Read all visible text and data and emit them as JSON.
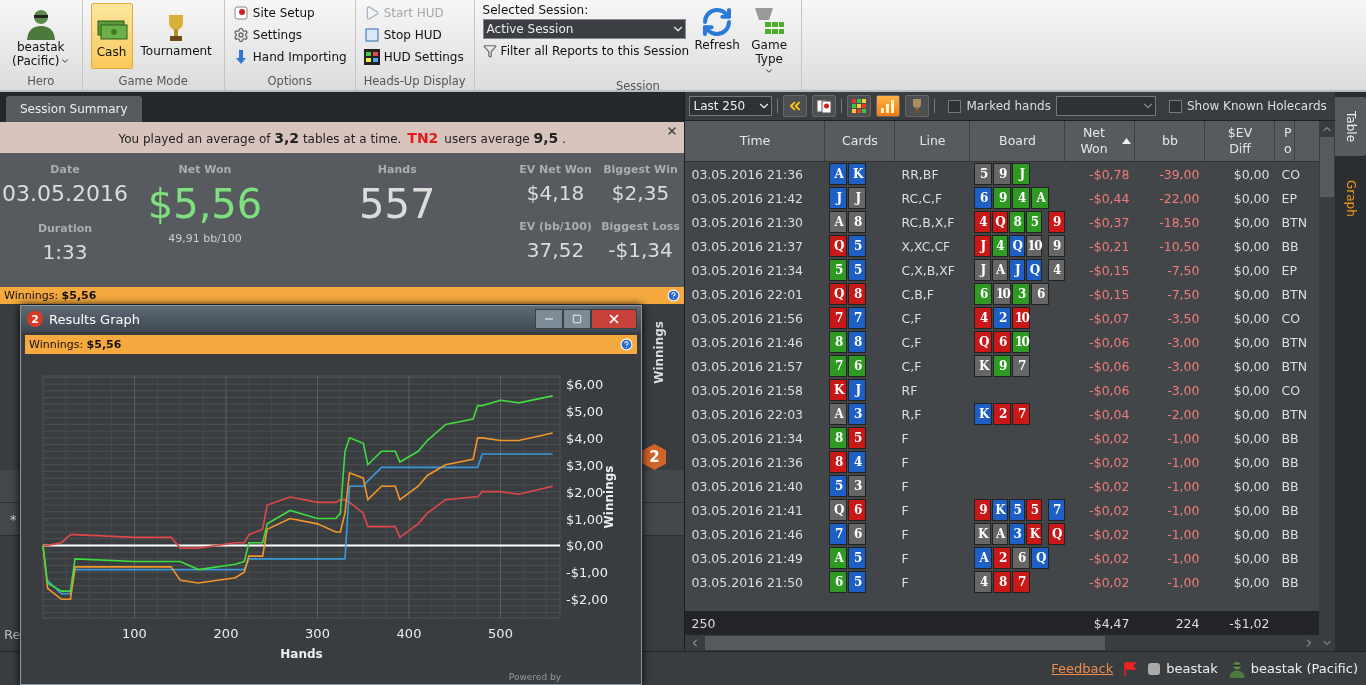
{
  "ribbon": {
    "groups": [
      {
        "kind": "hero",
        "title": "Hero",
        "user_line1": "beastak",
        "user_line2": "(Pacific)"
      },
      {
        "kind": "big",
        "title": "Game Mode",
        "buttons": [
          {
            "label": "Cash",
            "kind": "cash",
            "selected": true
          },
          {
            "label": "Tournament",
            "kind": "trophy",
            "selected": false
          }
        ]
      },
      {
        "kind": "list",
        "title": "Options",
        "items": [
          {
            "label": "Site Setup",
            "kind": "site",
            "disabled": false
          },
          {
            "label": "Settings",
            "kind": "gear",
            "disabled": false
          },
          {
            "label": "Hand Importing",
            "kind": "import",
            "disabled": false
          }
        ]
      },
      {
        "kind": "list",
        "title": "Heads-Up Display",
        "items": [
          {
            "label": "Start HUD",
            "kind": "play",
            "disabled": true
          },
          {
            "label": "Stop HUD",
            "kind": "stop",
            "disabled": false
          },
          {
            "label": "HUD Settings",
            "kind": "hud",
            "disabled": false
          }
        ]
      },
      {
        "kind": "session",
        "title": "Session",
        "label": "Selected Session:",
        "value": "Active Session",
        "filter": "Filter all Reports to this Session",
        "buttons": [
          {
            "label": "Refresh",
            "kind": "refresh"
          },
          {
            "label": "Game Type",
            "kind": "gametype"
          }
        ]
      }
    ]
  },
  "summary": {
    "tab": "Session Summary",
    "banner": {
      "text": "You played an average of **3,2** tables at a time.",
      "brand": "TN2",
      "text2": "users average **9,5** ."
    },
    "date": {
      "label": "Date",
      "value": "03.05.2016"
    },
    "duration": {
      "label": "Duration",
      "value": "1:33"
    },
    "net_won": {
      "label": "Net Won",
      "value": "$5,56",
      "sub": "49,91 bb/100"
    },
    "hands": {
      "label": "Hands",
      "value": "557"
    },
    "ev_net_won": {
      "label": "EV Net Won",
      "value": "$4,18"
    },
    "biggest_win": {
      "label": "Biggest Win",
      "value": "$2,35"
    },
    "ev_bb": {
      "label": "EV (bb/100)",
      "value": "37,52"
    },
    "biggest_loss": {
      "label": "Biggest Loss",
      "value": "-$1,34"
    },
    "winnings_bar": "Winnings: **$5,56**"
  },
  "back_panel": {
    "axis_label": "Winnings",
    "badge": "2",
    "marker": "*",
    "tab_stub": "Re"
  },
  "graph_window": {
    "badge": "2",
    "title": "Results Graph",
    "header": "Winnings: **$5,56**",
    "powered_by": "Powered by",
    "chart_data": {
      "type": "line",
      "grid": true,
      "xlabel": "Hands",
      "ylabel": "Winnings",
      "xlim": [
        0,
        565
      ],
      "ylim": [
        -2.7,
        6.3
      ],
      "x": [
        0,
        5,
        20,
        30,
        35,
        100,
        140,
        150,
        170,
        210,
        220,
        225,
        240,
        245,
        270,
        300,
        320,
        325,
        330,
        335,
        350,
        355,
        370,
        385,
        390,
        410,
        420,
        440,
        470,
        475,
        480,
        500,
        520,
        557
      ],
      "xticks": [
        100,
        200,
        300,
        400,
        500
      ],
      "yticks": [
        {
          "value": 6,
          "label": "$6,00"
        },
        {
          "value": 5,
          "label": "$5,00"
        },
        {
          "value": 4,
          "label": "$4,00"
        },
        {
          "value": 3,
          "label": "$3,00"
        },
        {
          "value": 2,
          "label": "$2,00"
        },
        {
          "value": 1,
          "label": "$1,00"
        },
        {
          "value": 0,
          "label": "$0,00"
        },
        {
          "value": -1,
          "label": "-$1,00"
        },
        {
          "value": -2,
          "label": "-$2,00"
        }
      ],
      "series": [
        {
          "color": "#e04848",
          "values": [
            0,
            0,
            0.1,
            0.4,
            0.4,
            0.3,
            0.3,
            -0.1,
            -0.1,
            0.1,
            0.1,
            0.4,
            0.6,
            1.5,
            1.8,
            1.6,
            1.6,
            1.7,
            1.7,
            1.6,
            1.2,
            0.7,
            0.7,
            0.7,
            0.3,
            0.8,
            1.2,
            1.7,
            1.8,
            1.8,
            2.0,
            2.0,
            1.9,
            2.2
          ]
        },
        {
          "color": "#3a9ad9",
          "values": [
            null,
            -1.3,
            -1.8,
            -1.8,
            -0.9,
            -0.9,
            -0.9,
            -0.9,
            -0.9,
            -0.9,
            -0.9,
            -0.5,
            -0.5,
            -0.5,
            -0.5,
            -0.5,
            -0.5,
            -0.5,
            -0.5,
            2.2,
            2.2,
            2.4,
            2.9,
            2.9,
            2.9,
            2.9,
            2.9,
            2.9,
            2.9,
            2.9,
            3.4,
            3.4,
            3.4,
            3.4
          ]
        },
        {
          "color": "#f0962a",
          "values": [
            0,
            -1.6,
            -2.0,
            -2.0,
            -0.8,
            -0.8,
            -0.8,
            -1.3,
            -1.4,
            -1.2,
            -1.0,
            -0.4,
            -0.4,
            0.6,
            1.0,
            0.8,
            0.5,
            0.5,
            1.2,
            2.7,
            2.5,
            1.7,
            2.2,
            2.2,
            1.7,
            2.2,
            2.6,
            3.0,
            3.2,
            4.0,
            4.0,
            3.9,
            3.9,
            4.18
          ]
        },
        {
          "color": "#3fdc3f",
          "values": [
            0,
            -1.4,
            -1.7,
            -1.7,
            -0.5,
            -0.6,
            -0.6,
            -0.6,
            -0.9,
            -0.7,
            -0.6,
            0.1,
            0.1,
            0.8,
            1.3,
            1.0,
            1.0,
            1.2,
            3.5,
            4.0,
            3.8,
            3.0,
            3.5,
            3.5,
            3.1,
            3.5,
            3.9,
            4.5,
            4.7,
            5.2,
            5.2,
            5.4,
            5.3,
            5.56
          ]
        }
      ]
    }
  },
  "table": {
    "toolbar": {
      "range": "Last 250",
      "buttons": [
        {
          "kind": "rewind",
          "selected": false
        },
        {
          "kind": "cards",
          "selected": false
        },
        {
          "kind": "grid",
          "selected": false
        },
        {
          "kind": "bars",
          "selected": true
        },
        {
          "kind": "trophy",
          "selected": false
        }
      ],
      "marked_hands": {
        "label": "Marked hands",
        "checked": false
      },
      "show_known": {
        "label": "Show Known Holecards",
        "checked": false
      }
    },
    "columns": [
      {
        "label": "Time",
        "sorted": false
      },
      {
        "label": "Cards",
        "sorted": false
      },
      {
        "label": "Line",
        "sorted": false
      },
      {
        "label": "Board",
        "sorted": false
      },
      {
        "label": "Net Won",
        "sorted": true
      },
      {
        "label": "bb",
        "sorted": false
      },
      {
        "label": "$EV Diff",
        "sorted": false
      },
      {
        "label": "Po",
        "sorted": false
      }
    ],
    "rows": [
      {
        "time": "03.05.2016 21:36",
        "cards": [
          {
            "rank": "A",
            "color": "#1d5fc4"
          },
          {
            "rank": "K",
            "color": "#1d5fc4"
          }
        ],
        "line": "RR,BF",
        "board": [
          {
            "rank": "5",
            "color": "#666666"
          },
          {
            "rank": "9",
            "color": "#666666"
          },
          {
            "rank": "J",
            "color": "#2f9a23"
          }
        ],
        "net": "-$0,78",
        "bb": "-39,00",
        "ev": "$0,00",
        "pos": "CO"
      },
      {
        "time": "03.05.2016 21:42",
        "cards": [
          {
            "rank": "J",
            "color": "#1d5fc4"
          },
          {
            "rank": "J",
            "color": "#666666"
          }
        ],
        "line": "RC,C,F",
        "board": [
          {
            "rank": "6",
            "color": "#1d5fc4"
          },
          {
            "rank": "9",
            "color": "#2f9a23"
          },
          {
            "rank": "4",
            "color": "#2f9a23"
          },
          {
            "rank": "A",
            "color": "#2f9a23"
          }
        ],
        "net": "-$0,44",
        "bb": "-22,00",
        "ev": "$0,00",
        "pos": "EP"
      },
      {
        "time": "03.05.2016 21:30",
        "cards": [
          {
            "rank": "A",
            "color": "#666666"
          },
          {
            "rank": "8",
            "color": "#666666"
          }
        ],
        "line": "RC,B,X,F",
        "board": [
          {
            "rank": "4",
            "color": "#c81818"
          },
          {
            "rank": "Q",
            "color": "#c81818"
          },
          {
            "rank": "8",
            "color": "#2f9a23"
          },
          {
            "rank": "5",
            "color": "#2f9a23"
          },
          {
            "rank": "9",
            "color": "#c81818"
          }
        ],
        "net": "-$0,37",
        "bb": "-18,50",
        "ev": "$0,00",
        "pos": "BTN"
      },
      {
        "time": "03.05.2016 21:37",
        "cards": [
          {
            "rank": "Q",
            "color": "#c81818"
          },
          {
            "rank": "5",
            "color": "#1d5fc4"
          }
        ],
        "line": "X,XC,CF",
        "board": [
          {
            "rank": "J",
            "color": "#c81818"
          },
          {
            "rank": "4",
            "color": "#2f9a23"
          },
          {
            "rank": "Q",
            "color": "#1d5fc4"
          },
          {
            "rank": "10",
            "color": "#666666"
          },
          {
            "rank": "9",
            "color": "#666666"
          }
        ],
        "net": "-$0,21",
        "bb": "-10,50",
        "ev": "$0,00",
        "pos": "BB"
      },
      {
        "time": "03.05.2016 21:34",
        "cards": [
          {
            "rank": "5",
            "color": "#2f9a23"
          },
          {
            "rank": "5",
            "color": "#1d5fc4"
          }
        ],
        "line": "C,X,B,XF",
        "board": [
          {
            "rank": "J",
            "color": "#666666"
          },
          {
            "rank": "A",
            "color": "#666666"
          },
          {
            "rank": "J",
            "color": "#1d5fc4"
          },
          {
            "rank": "Q",
            "color": "#1d5fc4"
          },
          {
            "rank": "4",
            "color": "#666666"
          }
        ],
        "net": "-$0,15",
        "bb": "-7,50",
        "ev": "$0,00",
        "pos": "EP"
      },
      {
        "time": "03.05.2016 22:01",
        "cards": [
          {
            "rank": "Q",
            "color": "#c81818"
          },
          {
            "rank": "8",
            "color": "#c81818"
          }
        ],
        "line": "C,B,F",
        "board": [
          {
            "rank": "6",
            "color": "#2f9a23"
          },
          {
            "rank": "10",
            "color": "#666666"
          },
          {
            "rank": "3",
            "color": "#2f9a23"
          },
          {
            "rank": "6",
            "color": "#666666"
          }
        ],
        "net": "-$0,15",
        "bb": "-7,50",
        "ev": "$0,00",
        "pos": "BTN"
      },
      {
        "time": "03.05.2016 21:56",
        "cards": [
          {
            "rank": "7",
            "color": "#c81818"
          },
          {
            "rank": "7",
            "color": "#1d5fc4"
          }
        ],
        "line": "C,F",
        "board": [
          {
            "rank": "4",
            "color": "#c81818"
          },
          {
            "rank": "2",
            "color": "#1d5fc4"
          },
          {
            "rank": "10",
            "color": "#c81818"
          }
        ],
        "net": "-$0,07",
        "bb": "-3,50",
        "ev": "$0,00",
        "pos": "CO"
      },
      {
        "time": "03.05.2016 21:46",
        "cards": [
          {
            "rank": "8",
            "color": "#2f9a23"
          },
          {
            "rank": "8",
            "color": "#1d5fc4"
          }
        ],
        "line": "C,F",
        "board": [
          {
            "rank": "Q",
            "color": "#c81818"
          },
          {
            "rank": "6",
            "color": "#c81818"
          },
          {
            "rank": "10",
            "color": "#2f9a23"
          }
        ],
        "net": "-$0,06",
        "bb": "-3,00",
        "ev": "$0,00",
        "pos": "BTN"
      },
      {
        "time": "03.05.2016 21:57",
        "cards": [
          {
            "rank": "7",
            "color": "#2f9a23"
          },
          {
            "rank": "6",
            "color": "#2f9a23"
          }
        ],
        "line": "C,F",
        "board": [
          {
            "rank": "K",
            "color": "#666666"
          },
          {
            "rank": "9",
            "color": "#2f9a23"
          },
          {
            "rank": "7",
            "color": "#666666"
          }
        ],
        "net": "-$0,06",
        "bb": "-3,00",
        "ev": "$0,00",
        "pos": "BTN"
      },
      {
        "time": "03.05.2016 21:58",
        "cards": [
          {
            "rank": "K",
            "color": "#c81818"
          },
          {
            "rank": "J",
            "color": "#1d5fc4"
          }
        ],
        "line": "RF",
        "board": [],
        "net": "-$0,06",
        "bb": "-3,00",
        "ev": "$0,00",
        "pos": "CO"
      },
      {
        "time": "03.05.2016 22:03",
        "cards": [
          {
            "rank": "A",
            "color": "#666666"
          },
          {
            "rank": "3",
            "color": "#1d5fc4"
          }
        ],
        "line": "R,F",
        "board": [
          {
            "rank": "K",
            "color": "#1d5fc4"
          },
          {
            "rank": "2",
            "color": "#c81818"
          },
          {
            "rank": "7",
            "color": "#c81818"
          }
        ],
        "net": "-$0,04",
        "bb": "-2,00",
        "ev": "$0,00",
        "pos": "BTN"
      },
      {
        "time": "03.05.2016 21:34",
        "cards": [
          {
            "rank": "8",
            "color": "#2f9a23"
          },
          {
            "rank": "5",
            "color": "#c81818"
          }
        ],
        "line": "F",
        "board": [],
        "net": "-$0,02",
        "bb": "-1,00",
        "ev": "$0,00",
        "pos": "BB"
      },
      {
        "time": "03.05.2016 21:36",
        "cards": [
          {
            "rank": "8",
            "color": "#c81818"
          },
          {
            "rank": "4",
            "color": "#1d5fc4"
          }
        ],
        "line": "F",
        "board": [],
        "net": "-$0,02",
        "bb": "-1,00",
        "ev": "$0,00",
        "pos": "BB"
      },
      {
        "time": "03.05.2016 21:40",
        "cards": [
          {
            "rank": "5",
            "color": "#1d5fc4"
          },
          {
            "rank": "3",
            "color": "#666666"
          }
        ],
        "line": "F",
        "board": [],
        "net": "-$0,02",
        "bb": "-1,00",
        "ev": "$0,00",
        "pos": "BB"
      },
      {
        "time": "03.05.2016 21:41",
        "cards": [
          {
            "rank": "Q",
            "color": "#666666"
          },
          {
            "rank": "6",
            "color": "#c81818"
          }
        ],
        "line": "F",
        "board": [
          {
            "rank": "9",
            "color": "#c81818"
          },
          {
            "rank": "K",
            "color": "#1d5fc4"
          },
          {
            "rank": "5",
            "color": "#1d5fc4"
          },
          {
            "rank": "5",
            "color": "#c81818"
          },
          {
            "rank": "7",
            "color": "#1d5fc4"
          }
        ],
        "net": "-$0,02",
        "bb": "-1,00",
        "ev": "$0,00",
        "pos": "BB"
      },
      {
        "time": "03.05.2016 21:46",
        "cards": [
          {
            "rank": "7",
            "color": "#1d5fc4"
          },
          {
            "rank": "6",
            "color": "#666666"
          }
        ],
        "line": "F",
        "board": [
          {
            "rank": "K",
            "color": "#666666"
          },
          {
            "rank": "A",
            "color": "#666666"
          },
          {
            "rank": "3",
            "color": "#1d5fc4"
          },
          {
            "rank": "K",
            "color": "#c81818"
          },
          {
            "rank": "Q",
            "color": "#c81818"
          }
        ],
        "net": "-$0,02",
        "bb": "-1,00",
        "ev": "$0,00",
        "pos": "BB"
      },
      {
        "time": "03.05.2016 21:49",
        "cards": [
          {
            "rank": "A",
            "color": "#2f9a23"
          },
          {
            "rank": "5",
            "color": "#1d5fc4"
          }
        ],
        "line": "F",
        "board": [
          {
            "rank": "A",
            "color": "#1d5fc4"
          },
          {
            "rank": "2",
            "color": "#c81818"
          },
          {
            "rank": "6",
            "color": "#666666"
          },
          {
            "rank": "Q",
            "color": "#1d5fc4"
          }
        ],
        "net": "-$0,02",
        "bb": "-1,00",
        "ev": "$0,00",
        "pos": "BB"
      },
      {
        "time": "03.05.2016 21:50",
        "cards": [
          {
            "rank": "6",
            "color": "#2f9a23"
          },
          {
            "rank": "5",
            "color": "#1d5fc4"
          }
        ],
        "line": "F",
        "board": [
          {
            "rank": "4",
            "color": "#666666"
          },
          {
            "rank": "8",
            "color": "#c81818"
          },
          {
            "rank": "7",
            "color": "#c81818"
          }
        ],
        "net": "-$0,02",
        "bb": "-1,00",
        "ev": "$0,00",
        "pos": "BB"
      }
    ],
    "footer": {
      "count": "250",
      "net": "$4,47",
      "bb": "224",
      "ev": "-$1,02"
    }
  },
  "side_tabs": [
    {
      "label": "Table",
      "selected": true
    },
    {
      "label": "Graph",
      "selected": false
    }
  ],
  "status_bar": {
    "feedback": "Feedback",
    "site_user": "beastak",
    "hero": "beastak (Pacific)"
  }
}
